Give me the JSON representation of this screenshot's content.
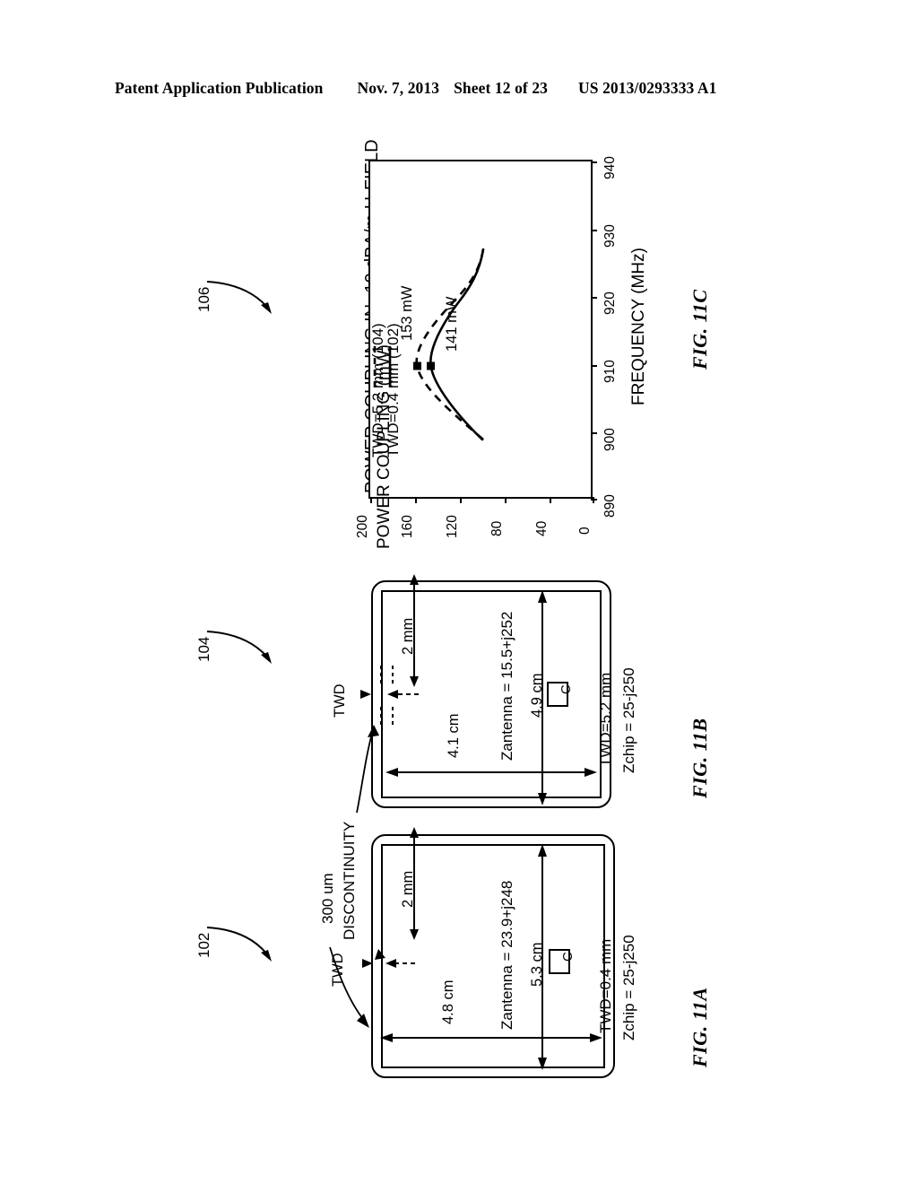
{
  "header": {
    "publication": "Patent Application Publication",
    "date": "Nov. 7, 2013",
    "sheet": "Sheet 12 of 23",
    "patent_number": "US 2013/0293333 A1"
  },
  "figures": {
    "fig_11a": {
      "label": "FIG. 11A",
      "ref": "102",
      "width_dim": "4.8 cm",
      "height_dim": "5.3 cm",
      "gap_dim": "2 mm",
      "twd_label": "TWD",
      "z_antenna": "Zantenna = 23.9+j248",
      "twd_spec": "TWD=0.4 mm",
      "z_chip": "Zchip = 25-j250",
      "cap_label": "C"
    },
    "fig_11b": {
      "label": "FIG. 11B",
      "ref": "104",
      "width_dim": "4.1 cm",
      "height_dim": "4.9 cm",
      "gap_dim": "2 mm",
      "twd_label": "TWD",
      "z_antenna": "Zantenna = 15.5+j252",
      "twd_spec": "TWD=5.2 mm",
      "z_chip": "Zchip = 25-j250",
      "cap_label": "C"
    },
    "fig_11c": {
      "label": "FIG. 11C",
      "ref": "106"
    },
    "discontinuity_note": "300 um\nDISCONTINUITY",
    "discontinuity_line1": "300 um",
    "discontinuity_line2": "DISCONTINUITY"
  },
  "chart_data": {
    "type": "line",
    "title": "POWER COUPLING IN -10 dBA/m H-FIELD",
    "xlabel": "FREQUENCY (MHz)",
    "ylabel": "POWER COUPLING (mW)",
    "xlim": [
      890,
      940
    ],
    "ylim": [
      0,
      200
    ],
    "xticks": [
      890,
      900,
      910,
      920,
      930,
      940
    ],
    "yticks": [
      0,
      40,
      80,
      120,
      160,
      200
    ],
    "grid": false,
    "legend_position": "inside-lower-left",
    "series": [
      {
        "name": "TWD=0.4 mm (102)",
        "style": "solid",
        "peak_label": "141 mW",
        "peak_x": 913,
        "peak_y": 141,
        "x": [
          899,
          901,
          903,
          905,
          907,
          909,
          911,
          913,
          915,
          917,
          919,
          921,
          923,
          925,
          927
        ],
        "y": [
          100,
          110,
          119,
          127,
          133,
          138,
          140,
          141,
          140,
          137,
          132,
          126,
          119,
          111,
          102
        ]
      },
      {
        "name": "TWD=5.2 mm (104)",
        "style": "dashed",
        "peak_label": "153 mW",
        "peak_x": 913,
        "peak_y": 153,
        "x": [
          899,
          901,
          903,
          905,
          907,
          909,
          911,
          913,
          915,
          917,
          919,
          921,
          923,
          925,
          927
        ],
        "y": [
          99,
          110,
          121,
          132,
          141,
          148,
          152,
          153,
          151,
          146,
          139,
          131,
          122,
          112,
          102
        ]
      }
    ],
    "annotations": [
      {
        "text": "153 mW",
        "x": 913,
        "y": 153
      },
      {
        "text": "141 mW",
        "x": 913,
        "y": 141
      }
    ]
  }
}
